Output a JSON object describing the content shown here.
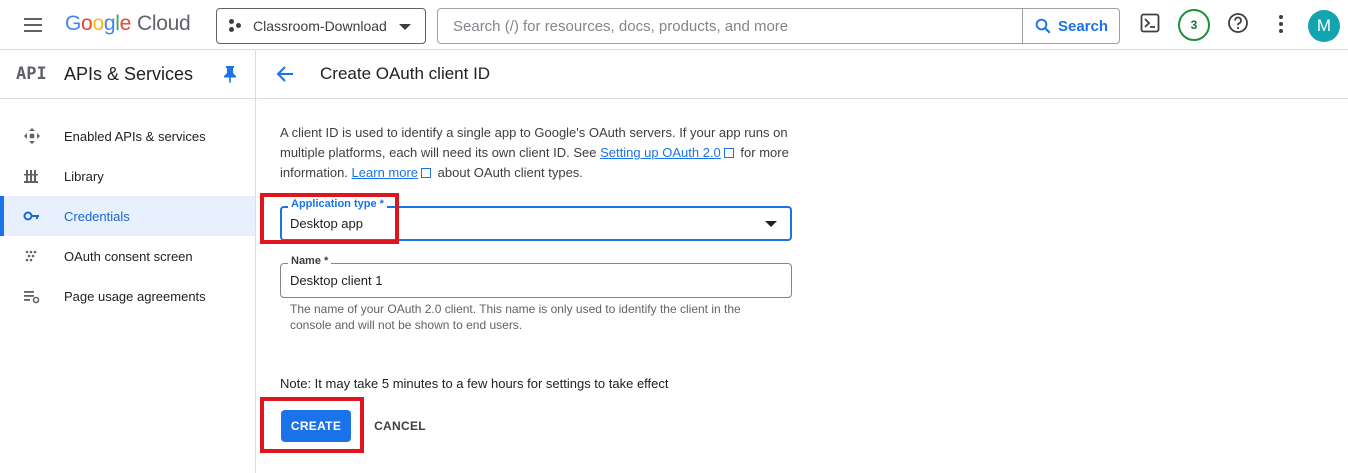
{
  "topbar": {
    "logo": {
      "g1": "G",
      "g2": "o",
      "g3": "o",
      "g4": "g",
      "g5": "l",
      "g6": "e",
      "product": "Cloud"
    },
    "project": "Classroom-Download",
    "search_placeholder": "Search (/) for resources, docs, products, and more",
    "search_button": "Search",
    "notification_count": "3",
    "avatar_initial": "M"
  },
  "sidebar": {
    "logo": "API",
    "title": "APIs & Services",
    "items": [
      {
        "label": "Enabled APIs & services",
        "icon": "move-icon"
      },
      {
        "label": "Library",
        "icon": "library-icon"
      },
      {
        "label": "Credentials",
        "icon": "key-icon",
        "active": true
      },
      {
        "label": "OAuth consent screen",
        "icon": "consent-icon"
      },
      {
        "label": "Page usage agreements",
        "icon": "settings-list-icon"
      }
    ]
  },
  "main": {
    "title": "Create OAuth client ID",
    "desc_1": "A client ID is used to identify a single app to Google's OAuth servers. If your app runs on multiple platforms, each will need its own client ID. See ",
    "desc_link_1": "Setting up OAuth 2.0",
    "desc_2": "for more information. ",
    "desc_link_2": "Learn more",
    "desc_3": "about OAuth client types.",
    "app_type_label": "Application type *",
    "app_type_value": "Desktop app",
    "name_label": "Name *",
    "name_value": "Desktop client 1",
    "name_hint": "The name of your OAuth 2.0 client. This name is only used to identify the client in the console and will not be shown to end users.",
    "note": "Note: It may take 5 minutes to a few hours for settings to take effect",
    "create_label": "CREATE",
    "cancel_label": "CANCEL"
  },
  "colors": {
    "accent": "#1a73e8",
    "highlight": "#e0161e",
    "avatar": "#12a4af"
  }
}
